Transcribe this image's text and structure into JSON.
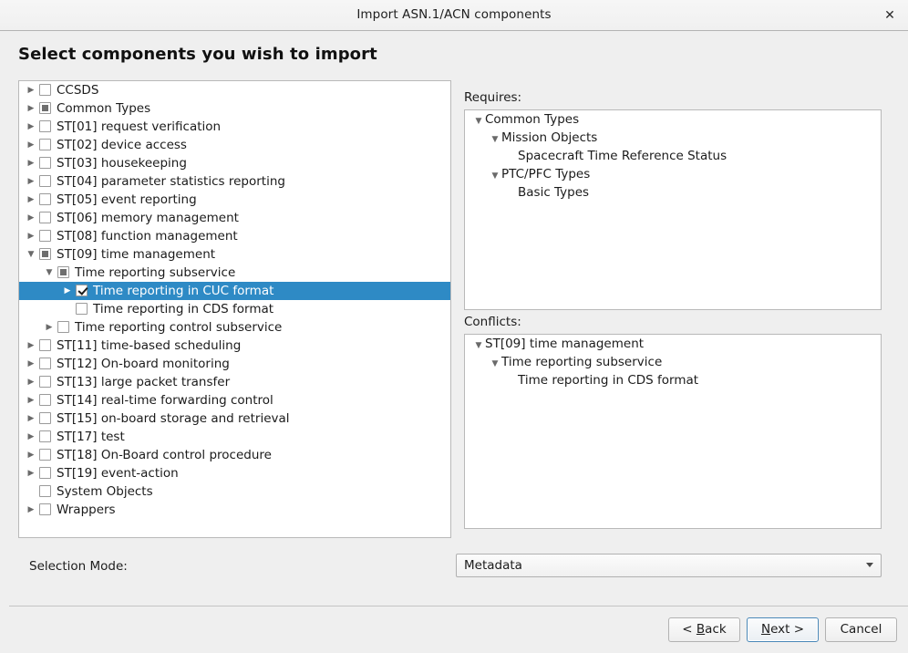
{
  "window": {
    "title": "Import ASN.1/ACN components",
    "close_icon": "close-icon"
  },
  "heading": "Select components you wish to import",
  "tree": {
    "items": [
      {
        "label": "CCSDS",
        "depth": 0,
        "arrow": "collapsed",
        "check": "unchecked",
        "selected": false
      },
      {
        "label": "Common Types",
        "depth": 0,
        "arrow": "collapsed",
        "check": "partial",
        "selected": false
      },
      {
        "label": "ST[01] request verification",
        "depth": 0,
        "arrow": "collapsed",
        "check": "unchecked",
        "selected": false
      },
      {
        "label": "ST[02] device access",
        "depth": 0,
        "arrow": "collapsed",
        "check": "unchecked",
        "selected": false
      },
      {
        "label": "ST[03] housekeeping",
        "depth": 0,
        "arrow": "collapsed",
        "check": "unchecked",
        "selected": false
      },
      {
        "label": "ST[04] parameter statistics reporting",
        "depth": 0,
        "arrow": "collapsed",
        "check": "unchecked",
        "selected": false
      },
      {
        "label": "ST[05] event reporting",
        "depth": 0,
        "arrow": "collapsed",
        "check": "unchecked",
        "selected": false
      },
      {
        "label": "ST[06] memory management",
        "depth": 0,
        "arrow": "collapsed",
        "check": "unchecked",
        "selected": false
      },
      {
        "label": "ST[08] function management",
        "depth": 0,
        "arrow": "collapsed",
        "check": "unchecked",
        "selected": false
      },
      {
        "label": "ST[09] time management",
        "depth": 0,
        "arrow": "expanded",
        "check": "partial",
        "selected": false
      },
      {
        "label": "Time reporting subservice",
        "depth": 1,
        "arrow": "expanded",
        "check": "partial",
        "selected": false
      },
      {
        "label": "Time reporting in CUC format",
        "depth": 2,
        "arrow": "none",
        "check": "checked",
        "selected": true
      },
      {
        "label": "Time reporting in CDS format",
        "depth": 2,
        "arrow": "none",
        "check": "unchecked",
        "selected": false
      },
      {
        "label": "Time reporting control subservice",
        "depth": 1,
        "arrow": "collapsed",
        "check": "unchecked",
        "selected": false
      },
      {
        "label": "ST[11] time-based scheduling",
        "depth": 0,
        "arrow": "collapsed",
        "check": "unchecked",
        "selected": false
      },
      {
        "label": "ST[12] On-board monitoring",
        "depth": 0,
        "arrow": "collapsed",
        "check": "unchecked",
        "selected": false
      },
      {
        "label": "ST[13] large packet transfer",
        "depth": 0,
        "arrow": "collapsed",
        "check": "unchecked",
        "selected": false
      },
      {
        "label": "ST[14] real-time forwarding control",
        "depth": 0,
        "arrow": "collapsed",
        "check": "unchecked",
        "selected": false
      },
      {
        "label": "ST[15] on-board storage and retrieval",
        "depth": 0,
        "arrow": "collapsed",
        "check": "unchecked",
        "selected": false
      },
      {
        "label": "ST[17] test",
        "depth": 0,
        "arrow": "collapsed",
        "check": "unchecked",
        "selected": false
      },
      {
        "label": "ST[18] On-Board control procedure",
        "depth": 0,
        "arrow": "collapsed",
        "check": "unchecked",
        "selected": false
      },
      {
        "label": "ST[19] event-action",
        "depth": 0,
        "arrow": "collapsed",
        "check": "unchecked",
        "selected": false
      },
      {
        "label": "System Objects",
        "depth": 0,
        "arrow": "none",
        "check": "unchecked",
        "selected": false
      },
      {
        "label": "Wrappers",
        "depth": 0,
        "arrow": "collapsed",
        "check": "unchecked",
        "selected": false
      }
    ]
  },
  "requires": {
    "label": "Requires:",
    "items": [
      {
        "label": "Common Types",
        "depth": 0,
        "arrow": "expanded"
      },
      {
        "label": "Mission Objects",
        "depth": 1,
        "arrow": "expanded"
      },
      {
        "label": "Spacecraft Time Reference Status",
        "depth": 2,
        "arrow": "none"
      },
      {
        "label": "PTC/PFC Types",
        "depth": 1,
        "arrow": "expanded"
      },
      {
        "label": "Basic Types",
        "depth": 2,
        "arrow": "none"
      }
    ]
  },
  "conflicts": {
    "label": "Conflicts:",
    "items": [
      {
        "label": "ST[09] time management",
        "depth": 0,
        "arrow": "expanded"
      },
      {
        "label": "Time reporting subservice",
        "depth": 1,
        "arrow": "expanded"
      },
      {
        "label": "Time reporting in CDS format",
        "depth": 2,
        "arrow": "none"
      }
    ]
  },
  "selection_mode": {
    "label": "Selection Mode:",
    "value": "Metadata",
    "options": [
      "Metadata"
    ]
  },
  "footer": {
    "back": {
      "prefix": "< ",
      "mnemonic": "B",
      "suffix": "ack"
    },
    "next": {
      "prefix": "",
      "mnemonic": "N",
      "suffix": "ext >"
    },
    "cancel": "Cancel"
  },
  "colors": {
    "selection_blue": "#2e8ac5",
    "window_bg": "#efefef",
    "panel_bg": "#ffffff",
    "focus_border": "#4a88b8"
  }
}
